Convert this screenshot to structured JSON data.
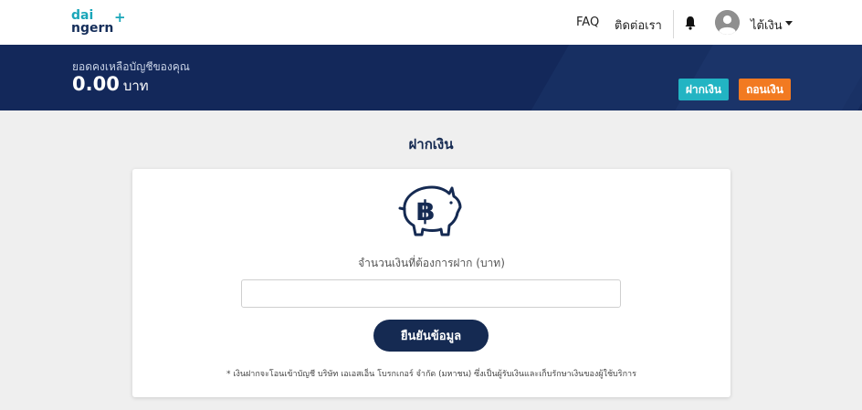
{
  "header": {
    "logo_line1": "dai",
    "logo_line2": "ngern",
    "logo_plus": "+",
    "nav_faq": "FAQ",
    "nav_contact": "ติดต่อเรา",
    "user_name": "ไต้เงิน",
    "bell_icon": "bell-icon",
    "avatar_icon": "user-avatar-icon",
    "caret_icon": "caret-down-icon"
  },
  "balance": {
    "label": "ยอดคงเหลือบัญชีของคุณ",
    "value": "0.00",
    "unit": "บาท",
    "deposit_label": "ฝากเงิน",
    "withdraw_label": "ถอนเงิน"
  },
  "deposit": {
    "title": "ฝากเงิน",
    "icon": "piggy-bank-baht-icon",
    "amount_label": "จำนวนเงินที่ต้องการฝาก (บาท)",
    "amount_value": "",
    "amount_placeholder": "",
    "confirm_label": "ยืนยันข้อมูล",
    "footnote": "* เงินฝากจะโอนเข้าบัญชี บริษัท เอเอสเอ็น โบรกเกอร์ จำกัด (มหาชน) ซึ่งเป็นผู้รับเงินและเก็บรักษาเงินของผู้ใช้บริการ"
  },
  "colors": {
    "navy": "#13285a",
    "teal": "#22b4c3",
    "orange": "#f27a21",
    "background": "#efefef"
  }
}
